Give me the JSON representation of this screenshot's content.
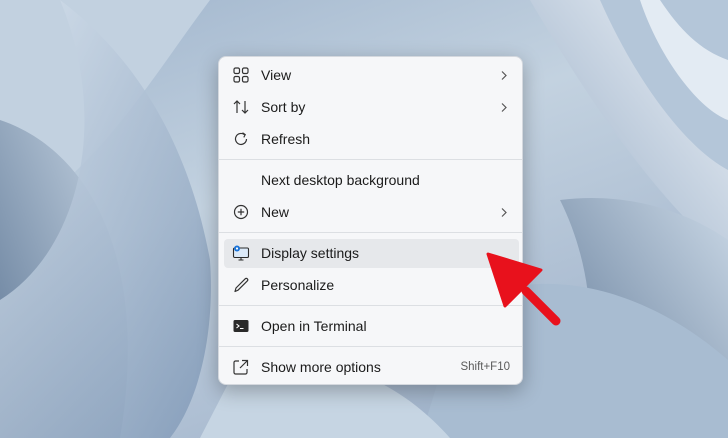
{
  "menu": {
    "items": [
      {
        "label": "View",
        "icon": "grid-icon",
        "submenu": true
      },
      {
        "label": "Sort by",
        "icon": "sort-icon",
        "submenu": true
      },
      {
        "label": "Refresh",
        "icon": "refresh-icon",
        "submenu": false
      },
      {
        "label": "Next desktop background",
        "icon": "",
        "submenu": false
      },
      {
        "label": "New",
        "icon": "plus-circle-icon",
        "submenu": true
      },
      {
        "label": "Display settings",
        "icon": "display-settings-icon",
        "submenu": false,
        "highlighted": true
      },
      {
        "label": "Personalize",
        "icon": "pen-icon",
        "submenu": false
      },
      {
        "label": "Open in Terminal",
        "icon": "terminal-icon",
        "submenu": false
      },
      {
        "label": "Show more options",
        "icon": "share-icon",
        "submenu": false,
        "shortcut": "Shift+F10"
      }
    ]
  },
  "colors": {
    "menu_bg": "#f6f7f9",
    "highlight_bg": "#e6e8eb",
    "annotation_arrow": "#e8111c",
    "display_icon_accent": "#1a73d8"
  }
}
